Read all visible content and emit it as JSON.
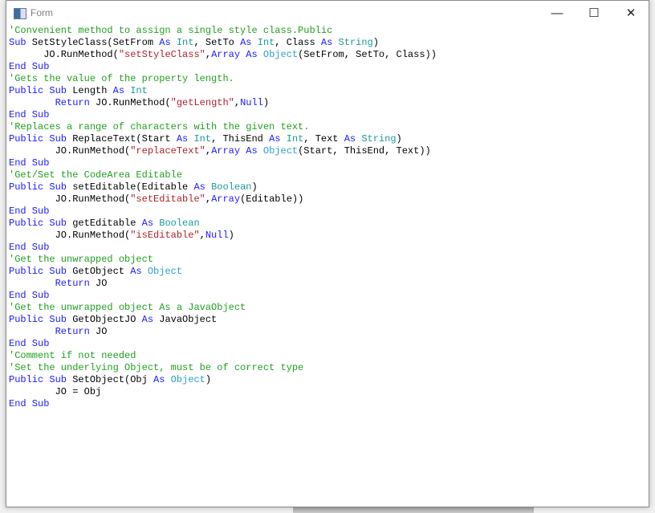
{
  "window": {
    "title": "Form",
    "icon": "form-icon",
    "controls": {
      "minimize": "—",
      "maximize": "☐",
      "close": "✕"
    }
  },
  "colors": {
    "keyword": "#1a1aff",
    "type": "#1a9a9a",
    "string": "#b0202a",
    "comment": "#20a020"
  },
  "code": [
    [
      [
        "cm",
        "'Convenient method to assign a single style class.Public"
      ]
    ],
    [
      [
        "kw",
        "Sub"
      ],
      [
        "pl",
        " SetStyleClass(SetFrom "
      ],
      [
        "kw",
        "As"
      ],
      [
        "pl",
        " "
      ],
      [
        "ty",
        "Int"
      ],
      [
        "pl",
        ", SetTo "
      ],
      [
        "kw",
        "As"
      ],
      [
        "pl",
        " "
      ],
      [
        "ty",
        "Int"
      ],
      [
        "pl",
        ", Class "
      ],
      [
        "kw",
        "As"
      ],
      [
        "pl",
        " "
      ],
      [
        "ty",
        "String"
      ],
      [
        "pl",
        ")"
      ]
    ],
    [
      [
        "pl",
        "      JO.RunMethod("
      ],
      [
        "str",
        "\"setStyleClass\""
      ],
      [
        "pl",
        ","
      ],
      [
        "kw",
        "Array"
      ],
      [
        "pl",
        " "
      ],
      [
        "kw",
        "As"
      ],
      [
        "pl",
        " "
      ],
      [
        "obj",
        "Object"
      ],
      [
        "pl",
        "(SetFrom, SetTo, Class))"
      ]
    ],
    [
      [
        "kw",
        "End Sub"
      ]
    ],
    [
      [
        "cm",
        "'Gets the value of the property length."
      ]
    ],
    [
      [
        "kw",
        "Public Sub"
      ],
      [
        "pl",
        " Length "
      ],
      [
        "kw",
        "As"
      ],
      [
        "pl",
        " "
      ],
      [
        "ty",
        "Int"
      ]
    ],
    [
      [
        "pl",
        "        "
      ],
      [
        "kw",
        "Return"
      ],
      [
        "pl",
        " JO.RunMethod("
      ],
      [
        "str",
        "\"getLength\""
      ],
      [
        "pl",
        ","
      ],
      [
        "kw",
        "Null"
      ],
      [
        "pl",
        ")"
      ]
    ],
    [
      [
        "kw",
        "End Sub"
      ]
    ],
    [
      [
        "cm",
        "'Replaces a range of characters with the given text."
      ]
    ],
    [
      [
        "kw",
        "Public Sub"
      ],
      [
        "pl",
        " ReplaceText(Start "
      ],
      [
        "kw",
        "As"
      ],
      [
        "pl",
        " "
      ],
      [
        "ty",
        "Int"
      ],
      [
        "pl",
        ", ThisEnd "
      ],
      [
        "kw",
        "As"
      ],
      [
        "pl",
        " "
      ],
      [
        "ty",
        "Int"
      ],
      [
        "pl",
        ", Text "
      ],
      [
        "kw",
        "As"
      ],
      [
        "pl",
        " "
      ],
      [
        "ty",
        "String"
      ],
      [
        "pl",
        ")"
      ]
    ],
    [
      [
        "pl",
        "        JO.RunMethod("
      ],
      [
        "str",
        "\"replaceText\""
      ],
      [
        "pl",
        ","
      ],
      [
        "kw",
        "Array"
      ],
      [
        "pl",
        " "
      ],
      [
        "kw",
        "As"
      ],
      [
        "pl",
        " "
      ],
      [
        "obj",
        "Object"
      ],
      [
        "pl",
        "(Start, ThisEnd, Text))"
      ]
    ],
    [
      [
        "kw",
        "End Sub"
      ]
    ],
    [
      [
        "cm",
        "'Get/Set the CodeArea Editable"
      ]
    ],
    [
      [
        "kw",
        "Public Sub"
      ],
      [
        "pl",
        " setEditable(Editable "
      ],
      [
        "kw",
        "As"
      ],
      [
        "pl",
        " "
      ],
      [
        "ty",
        "Boolean"
      ],
      [
        "pl",
        ")"
      ]
    ],
    [
      [
        "pl",
        "        JO.RunMethod("
      ],
      [
        "str",
        "\"setEditable\""
      ],
      [
        "pl",
        ","
      ],
      [
        "kw",
        "Array"
      ],
      [
        "pl",
        "(Editable))"
      ]
    ],
    [
      [
        "kw",
        "End Sub"
      ]
    ],
    [
      [
        "kw",
        "Public Sub"
      ],
      [
        "pl",
        " getEditable "
      ],
      [
        "kw",
        "As"
      ],
      [
        "pl",
        " "
      ],
      [
        "ty",
        "Boolean"
      ]
    ],
    [
      [
        "pl",
        "        JO.RunMethod("
      ],
      [
        "str",
        "\"isEditable\""
      ],
      [
        "pl",
        ","
      ],
      [
        "kw",
        "Null"
      ],
      [
        "pl",
        ")"
      ]
    ],
    [
      [
        "kw",
        "End Sub"
      ]
    ],
    [
      [
        "cm",
        "'Get the unwrapped object"
      ]
    ],
    [
      [
        "kw",
        "Public Sub"
      ],
      [
        "pl",
        " GetObject "
      ],
      [
        "kw",
        "As"
      ],
      [
        "pl",
        " "
      ],
      [
        "obj",
        "Object"
      ]
    ],
    [
      [
        "pl",
        "        "
      ],
      [
        "kw",
        "Return"
      ],
      [
        "pl",
        " JO"
      ]
    ],
    [
      [
        "kw",
        "End Sub"
      ]
    ],
    [
      [
        "cm",
        "'Get the unwrapped object As a JavaObject"
      ]
    ],
    [
      [
        "kw",
        "Public Sub"
      ],
      [
        "pl",
        " GetObjectJO "
      ],
      [
        "kw",
        "As"
      ],
      [
        "pl",
        " JavaObject"
      ]
    ],
    [
      [
        "pl",
        "        "
      ],
      [
        "kw",
        "Return"
      ],
      [
        "pl",
        " JO"
      ]
    ],
    [
      [
        "kw",
        "End Sub"
      ]
    ],
    [
      [
        "cm",
        "'Comment if not needed"
      ]
    ],
    [
      [
        "cm",
        "'Set the underlying Object, must be of correct type"
      ]
    ],
    [
      [
        "kw",
        "Public Sub"
      ],
      [
        "pl",
        " SetObject(Obj "
      ],
      [
        "kw",
        "As"
      ],
      [
        "pl",
        " "
      ],
      [
        "obj",
        "Object"
      ],
      [
        "pl",
        ")"
      ]
    ],
    [
      [
        "pl",
        "        JO = Obj"
      ]
    ],
    [
      [
        "kw",
        "End Sub"
      ]
    ]
  ]
}
